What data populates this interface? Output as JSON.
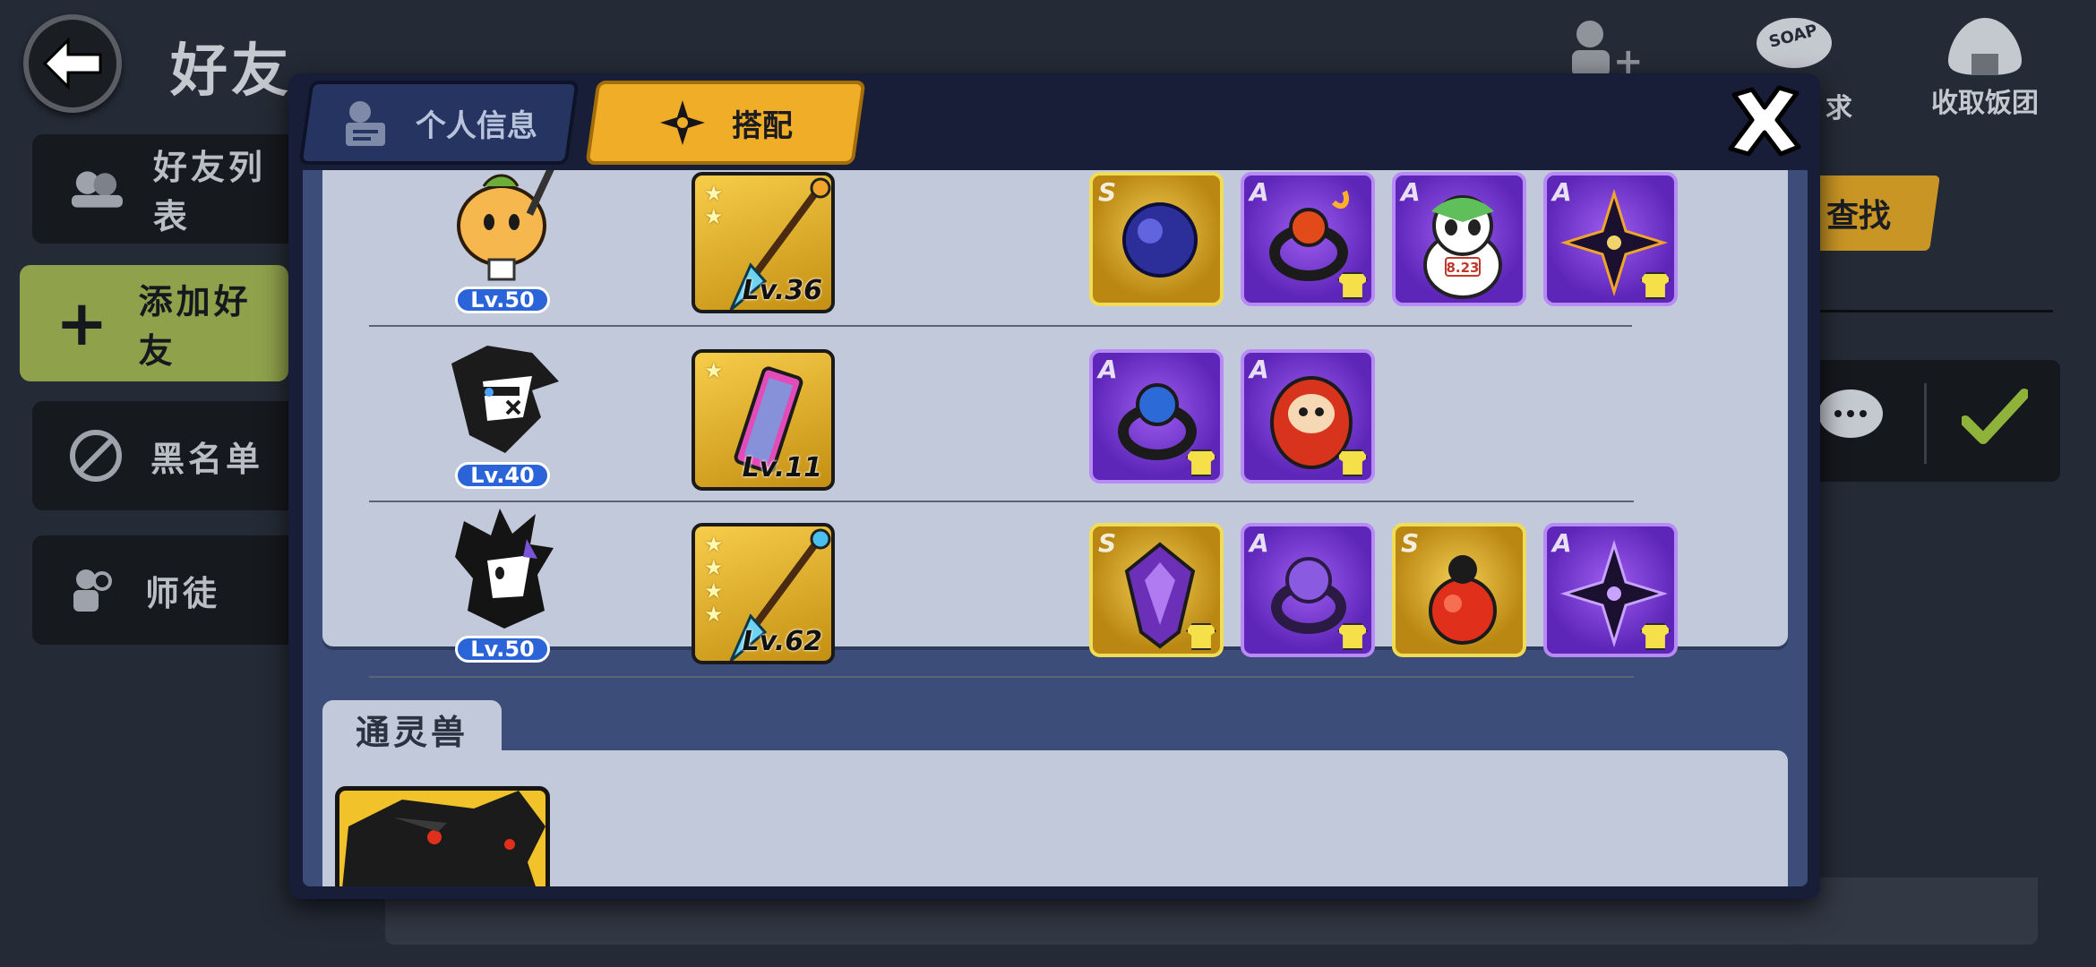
{
  "page": {
    "title": "好友"
  },
  "sidebar": {
    "items": [
      {
        "label": "好友列表"
      },
      {
        "label": "添加好友"
      },
      {
        "label": "黑名单"
      },
      {
        "label": "师徒"
      }
    ]
  },
  "top_actions": {
    "request_label": "求",
    "collect_label": "收取饭团",
    "soap_badge": "SOAP"
  },
  "search": {
    "label": "查找"
  },
  "modal": {
    "tabs": [
      {
        "label": "个人信息"
      },
      {
        "label": "搭配"
      }
    ],
    "active_tab": "搭配",
    "rows": [
      {
        "level": "Lv.50",
        "weapon_level": "Lv.36",
        "weapon_stars": 2,
        "items": [
          {
            "grade": "S",
            "icon": "dark-orb-icon"
          },
          {
            "grade": "A",
            "icon": "fire-ring-icon"
          },
          {
            "grade": "A",
            "icon": "panda-doll-icon",
            "tag": "8.23"
          },
          {
            "grade": "A",
            "icon": "shuriken-icon"
          }
        ]
      },
      {
        "level": "Lv.40",
        "weapon_level": "Lv.11",
        "weapon_stars": 1,
        "items": [
          {
            "grade": "A",
            "icon": "blue-ring-icon"
          },
          {
            "grade": "A",
            "icon": "daruma-icon"
          }
        ]
      },
      {
        "level": "Lv.50",
        "weapon_level": "Lv.62",
        "weapon_stars": 4,
        "items": [
          {
            "grade": "S",
            "icon": "purple-crystal-icon"
          },
          {
            "grade": "A",
            "icon": "purple-ring-icon"
          },
          {
            "grade": "S",
            "icon": "red-gourd-icon"
          },
          {
            "grade": "A",
            "icon": "shuriken-icon"
          }
        ]
      }
    ],
    "pet_section": {
      "title": "通灵兽"
    }
  },
  "colors": {
    "tab_active": "#f0ad28",
    "tab_inactive": "#253461",
    "panel": "#c1c9db",
    "grade_A": "#7b3fe0",
    "grade_S": "#e8b92a",
    "level_badge": "#2a64d8",
    "sidebar_active": "#8fa14b"
  }
}
